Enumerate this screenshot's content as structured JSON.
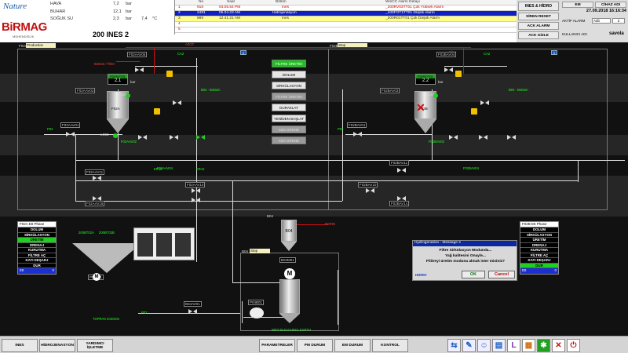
{
  "header": {
    "logo_nature": "Nature",
    "logo_birmag": "BiRMAG",
    "logo_birmag_sub": "MÜHENDİSLİK",
    "utilities": [
      {
        "name": "HAVA",
        "value": "7,2",
        "unit": "bar"
      },
      {
        "name": "BUHAR",
        "value": "12,1",
        "unit": "bar"
      },
      {
        "name": "SOĞUK SU",
        "value": "2,3",
        "unit": "bar",
        "temp": "7,4",
        "temp_unit": "°C"
      }
    ],
    "station_title": "200 INES 2"
  },
  "alarms": {
    "headers": {
      "no": "No",
      "saat": "Saat",
      "bolum": "Bölüm",
      "detay": "WinCC Alarm Detayı"
    },
    "rows": [
      {
        "idx": "1",
        "no": "916",
        "saat": "04.05.54 PM",
        "bolum": "Ines",
        "detay": "_200RV03TT01 Çok Yüksek Alarm"
      },
      {
        "idx": "2",
        "no": "2481",
        "saat": "05.04.23 AM",
        "bolum": "Hidrojenasyon",
        "detay": "_100FOT1TT01 Düşük Alarm"
      },
      {
        "idx": "3",
        "no": "889",
        "saat": "12.41.21 AM",
        "bolum": "Ines",
        "detay": "_200R01TT01 Çok Düşük Alarm"
      },
      {
        "idx": "4"
      },
      {
        "idx": "5"
      },
      {
        "idx": "6"
      }
    ]
  },
  "header_right": {
    "ines_hidro": "INES & HİDRO",
    "em_label": "EM",
    "cihaz_adi": "CİHAZ ADI",
    "siren_reset": "SİREN RESET",
    "datetime": "27.09.2018 16:16:34",
    "ack_alarm": "ACK ALARM",
    "aktif_alarm_label": "AKTİF ALARM",
    "aktif_alarm_value": "Adit",
    "aktif_alarm_count": "2",
    "ack_gizle": "ACK GİZLE",
    "kullanici_label": "KULLANICI ADI",
    "kullanici_value": "savola"
  },
  "process": {
    "f02a_tag": "F02A",
    "f02a_status": "Production",
    "f02b_tag": "F02B",
    "f02b_status": "Stop",
    "meter_a": {
      "label": "F02AQT01",
      "value": "2.1",
      "unit": "bar"
    },
    "meter_b": {
      "label": "F02BQT01",
      "value": "2.2",
      "unit": "bar"
    },
    "tag_labels": {
      "t1": "F02AAV05",
      "t2": "F02AAV03",
      "t3": "F02AAV01",
      "t4": "F02BAV03",
      "t5": "F02BAV04",
      "t6": "F02BAV01",
      "t7": "F02AAV11",
      "t8": "F02AAV15",
      "t9": "F02BAV11",
      "t10": "F02BAV14",
      "t11": "F02BAV10",
      "t12": "F02AAV10",
      "t13": "B04AV01",
      "t14": "B04BV01",
      "t15": "P04B01",
      "t16": "B04M01",
      "t17": "F02BAV06",
      "t18": "F02AAV06"
    },
    "labels": {
      "nitrogen": "AZOT",
      "p02": "P02",
      "p02b": "P02",
      "b04": "B04",
      "b04_title": "B04",
      "b04_status": "Stop",
      "b04b": "B04",
      "ls61": "LS61",
      "ls62": "LS61",
      "ls55": "LS55",
      "fdrin": "FDRIN",
      "wet": "WET BLEACHING EARTH",
      "p02_bottom": "P02",
      "top_red_a": "Bottom / Filter",
      "top_red_b": "Filter",
      "topraklar": "TOPRAK ESDOSI",
      "unit_a": "bar",
      "unit_b": "bar",
      "m": "M",
      "blue_a": "0",
      "blue_b": "0",
      "green_a1": "F02AAV02",
      "green_a2": "F02AAV04",
      "green_b1": "F02BAV02",
      "green_b2": "F02BAV04",
      "br_a": "200BT02A",
      "br_b": "200BT02B",
      "br_c": "P02B01",
      "tv_bottom_a": "B04 - Bottom",
      "tv_bottom_b": "B04 - Bottom",
      "fsl_a": "ER12",
      "fsl_b": "ER12",
      "t_ca": "CA2",
      "t_ca2": "CA2",
      "t_f02a": "F02A",
      "t_f02b": "F02B",
      "t_f02c": "F02A",
      "t_f02d": "F02B"
    },
    "control_buttons": [
      {
        "label": "FİLTRE ÜRETİM",
        "state": "active"
      },
      {
        "label": "DOLUM",
        "state": "normal"
      },
      {
        "label": "SİRKÜLASYON",
        "state": "normal"
      },
      {
        "label": "FİLTRE ÜRETİM",
        "state": "disabled"
      },
      {
        "label": "DURAKLAT",
        "state": "normal"
      },
      {
        "label": "YENİDEN BAŞLAT",
        "state": "normal"
      },
      {
        "label": "KEK DRENE",
        "state": "disabled"
      },
      {
        "label": "KEK DRENE",
        "state": "disabled"
      }
    ],
    "phase_a": {
      "title": "F02A Ett Phase",
      "items": [
        {
          "label": "DOLUM",
          "on": false
        },
        {
          "label": "SİRKÜLASYON",
          "on": false
        },
        {
          "label": "ÜRETİM",
          "on": true
        },
        {
          "label": "DRENAJ",
          "on": false
        },
        {
          "label": "KURUTMA",
          "on": false
        },
        {
          "label": "FİLTRE AÇ",
          "on": false
        },
        {
          "label": "KATI DEŞARJ",
          "on": false
        },
        {
          "label": "DUR",
          "on": false
        }
      ],
      "foot_label": "Ett",
      "foot_value": "0"
    },
    "phase_b": {
      "title": "F02B Ett Phase",
      "items": [
        {
          "label": "DOLUM",
          "on": false
        },
        {
          "label": "SİRKÜLASYON",
          "on": false
        },
        {
          "label": "ÜRETİM",
          "on": false
        },
        {
          "label": "DRENAJ",
          "on": false
        },
        {
          "label": "KURUTMA",
          "on": false
        },
        {
          "label": "FİLTRE AÇ",
          "on": false
        },
        {
          "label": "KATI DEŞARJ",
          "on": false
        },
        {
          "label": "DUR",
          "on": true
        }
      ],
      "foot_label": "Ett",
      "foot_value": "0"
    }
  },
  "dialog": {
    "title": "Hydrogenation - Message 2",
    "line1": "Filtre Sirkülasyon Modunda...",
    "line2": "Yağ kalitesini Onaylə...",
    "line3": "Filitreyi üretim moduna almak ister misiniz?",
    "source": "HIDRO",
    "ok": "OK",
    "cancel": "Cancel"
  },
  "footer": {
    "buttons_left": [
      "INES",
      "HİDROJENASYON",
      "YARDIMCI İŞLETME"
    ],
    "buttons_center": [
      "PARAMETRELER",
      "PM DURUM",
      "EM DURUM",
      "KONTROL"
    ],
    "icons": [
      {
        "name": "navigate-icon",
        "glyph": "⇆",
        "color": "#1e60c0"
      },
      {
        "name": "tools-icon",
        "glyph": "✎",
        "color": "#1e60c0"
      },
      {
        "name": "user-icon",
        "glyph": "☺",
        "color": "#1e60c0"
      },
      {
        "name": "document-icon",
        "glyph": "▤",
        "color": "#1e60c0"
      },
      {
        "name": "letter-l-icon",
        "glyph": "L",
        "color": "#7030a0"
      },
      {
        "name": "chart-icon",
        "glyph": "▦",
        "color": "#d07010"
      },
      {
        "name": "settings-icon",
        "glyph": "✱",
        "color": "#20a020"
      },
      {
        "name": "close-icon",
        "glyph": "✕",
        "color": "#c01010"
      },
      {
        "name": "power-icon",
        "glyph": "⏻",
        "color": "#c01010"
      }
    ]
  }
}
